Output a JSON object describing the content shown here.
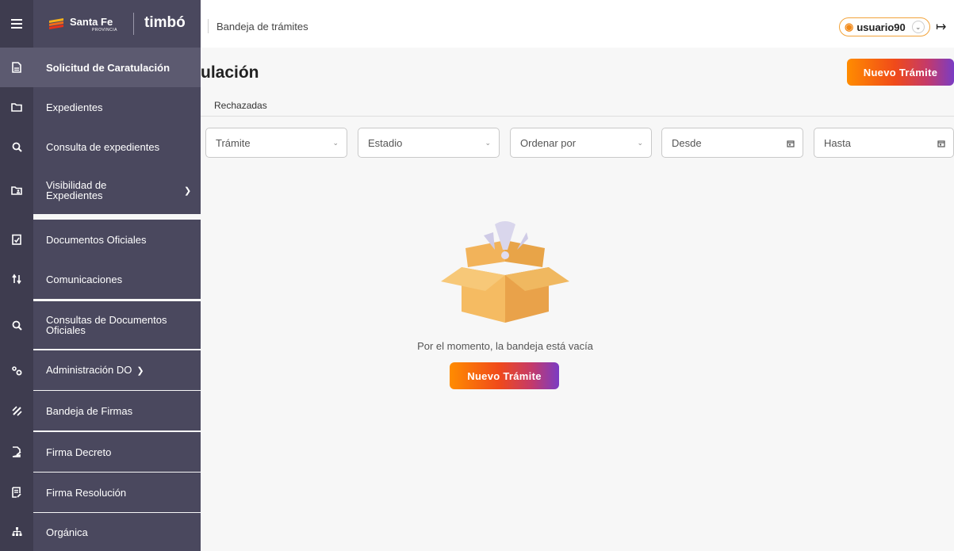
{
  "header": {
    "logo_santafe": "Santa Fe",
    "logo_provincia": "PROVINCIA",
    "logo_timbo": "timbó",
    "breadcrumb": "Bandeja de trámites",
    "user_name": "usuario90"
  },
  "sidebar": {
    "items": [
      {
        "label": "Solicitud de Caratulación",
        "icon": "document-icon"
      },
      {
        "label": "Expedientes",
        "icon": "folder-icon"
      },
      {
        "label": "Consulta de expedientes",
        "icon": "search-icon"
      },
      {
        "label": "Visibilidad de\nExpedientes",
        "icon": "folder-user-icon"
      },
      {
        "label": "Documentos Oficiales",
        "icon": "checklist-icon"
      },
      {
        "label": "Comunicaciones",
        "icon": "arrows-icon"
      },
      {
        "label": "Consultas de Documentos\nOficiales",
        "icon": "search-icon"
      },
      {
        "label": "Administración DO",
        "icon": "gears-icon"
      },
      {
        "label": "Bandeja de Firmas",
        "icon": "pen-icon"
      },
      {
        "label": "Firma Decreto",
        "icon": "file-sign-icon"
      },
      {
        "label": "Firma Resolución",
        "icon": "file-edit-icon"
      },
      {
        "label": "Orgánica",
        "icon": "sitemap-icon"
      }
    ]
  },
  "main": {
    "title": "ulación",
    "new_button": "Nuevo Trámite",
    "tab_rejected": "Rechazadas",
    "filters": {
      "tramite": "Trámite",
      "estadio": "Estadio",
      "ordenar": "Ordenar por",
      "desde": "Desde",
      "hasta": "Hasta"
    },
    "empty_message": "Por el momento, la bandeja está vacía",
    "empty_button": "Nuevo Trámite"
  },
  "colors": {
    "sidebar_bg": "#4a485e",
    "rail_bg": "#3e3c4f",
    "active_bg": "#5c5a70",
    "accent_orange": "#ff8c00",
    "accent_purple": "#7a3cc4"
  }
}
